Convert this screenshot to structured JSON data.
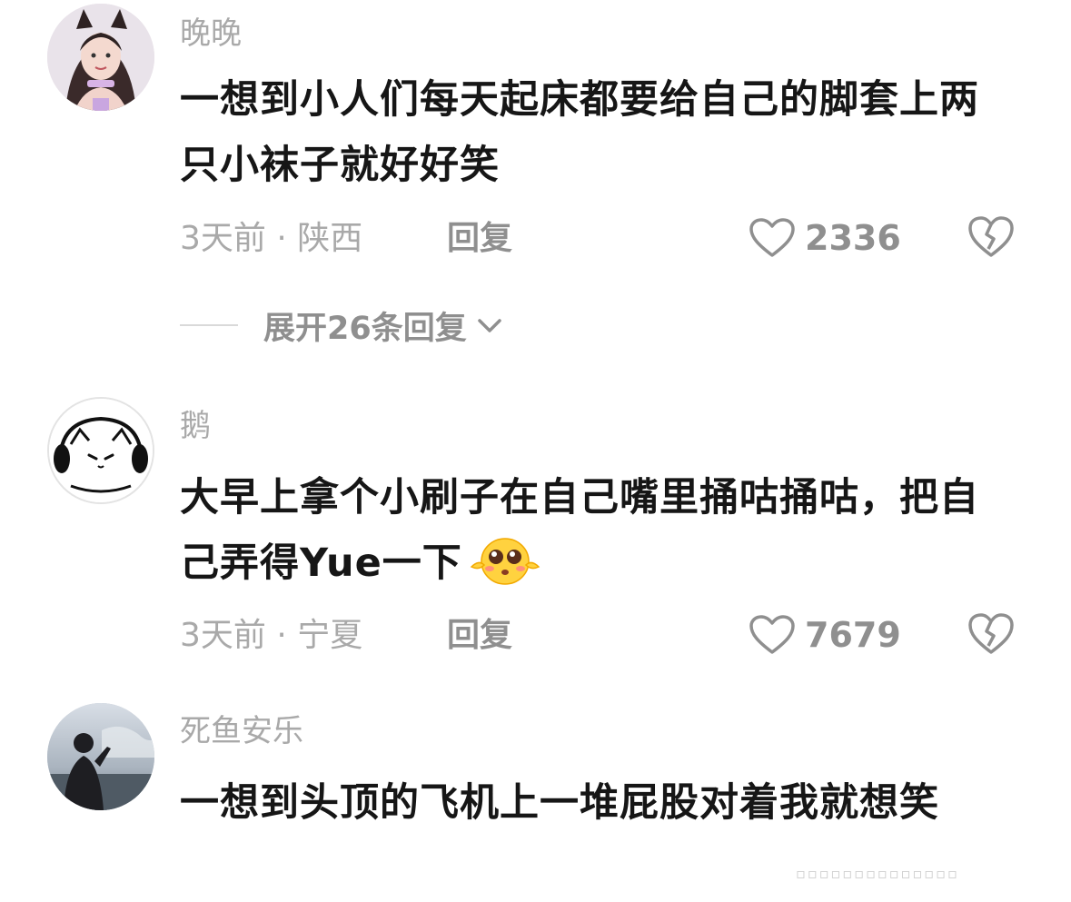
{
  "comments": [
    {
      "username": "晚晚",
      "text": "一想到小人们每天起床都要给自己的脚套上两只小袜子就好好笑",
      "time": "3天前 · 陕西",
      "reply_label": "回复",
      "likes": "2336",
      "expand_label": "展开26条回复",
      "avatar": "girl-with-cat-ears-avatar"
    },
    {
      "username": "鹅",
      "text": "大早上拿个小刷子在自己嘴里捅咕捅咕，把自己弄得Yue一下",
      "time": "3天前 · 宁夏",
      "reply_label": "回复",
      "likes": "7679",
      "emoji": "pleading-face-emoji",
      "avatar": "cartoon-headphones-avatar"
    },
    {
      "username": "死鱼安乐",
      "text": "一想到头顶的飞机上一堆屁股对着我就想笑",
      "avatar": "silhouette-sea-avatar"
    }
  ],
  "icons": {
    "like": "heart-outline-icon",
    "dislike": "broken-heart-icon",
    "expand": "chevron-down-icon"
  },
  "colors": {
    "primary_text": "#161616",
    "secondary_text": "#a9a9a9",
    "action_text": "#8f8f8f"
  }
}
